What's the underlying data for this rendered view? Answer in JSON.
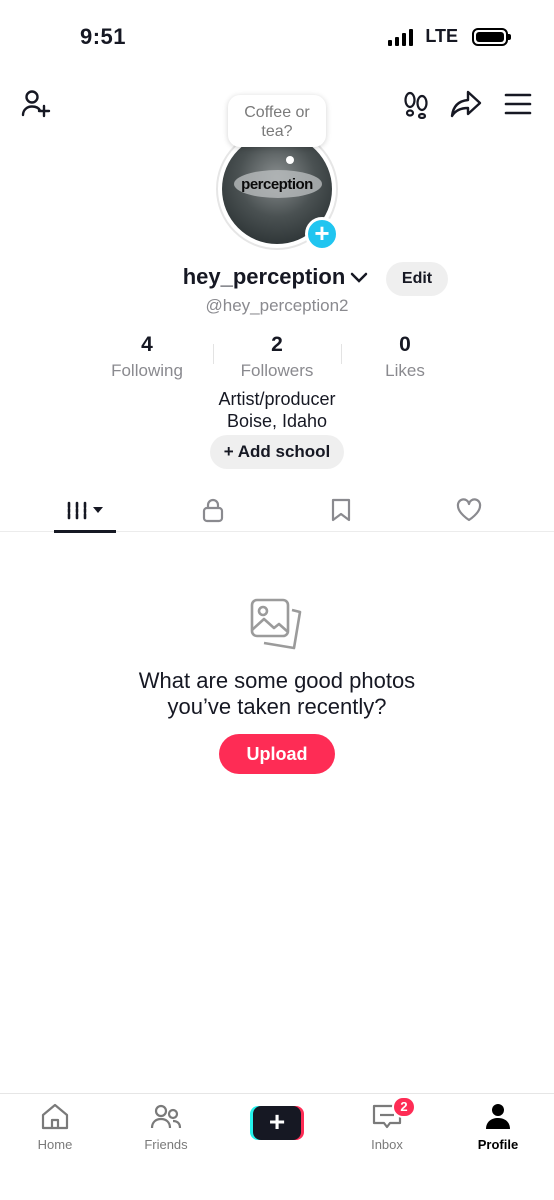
{
  "status_bar": {
    "time": "9:51",
    "network": "LTE"
  },
  "header": {
    "icons": [
      "add-friend-icon",
      "footprints-icon",
      "share-icon",
      "menu-icon"
    ]
  },
  "profile": {
    "bubble_text": "Coffee or tea?",
    "avatar_text": "perception",
    "username": "hey_perception",
    "handle": "@hey_perception2",
    "edit_label": "Edit",
    "stats": [
      {
        "value": "4",
        "label": "Following"
      },
      {
        "value": "2",
        "label": "Followers"
      },
      {
        "value": "0",
        "label": "Likes"
      }
    ],
    "bio_line1": "Artist/producer",
    "bio_line2": "Boise, Idaho",
    "add_school_label": "+ Add school"
  },
  "tabs": {
    "items": [
      "grid-icon",
      "lock-icon",
      "bookmark-icon",
      "heart-icon"
    ],
    "active": "grid-icon"
  },
  "empty_state": {
    "icon": "photos-icon",
    "title_line1": "What are some good photos",
    "title_line2": "you’ve taken recently?",
    "button_label": "Upload"
  },
  "bottom_nav": {
    "home": "Home",
    "friends": "Friends",
    "create": "+",
    "inbox": "Inbox",
    "inbox_badge": "2",
    "profile": "Profile"
  },
  "colors": {
    "accent": "#fe2c55",
    "cyan": "#20c5f0",
    "text": "#161823",
    "muted": "#8a8a8f"
  }
}
